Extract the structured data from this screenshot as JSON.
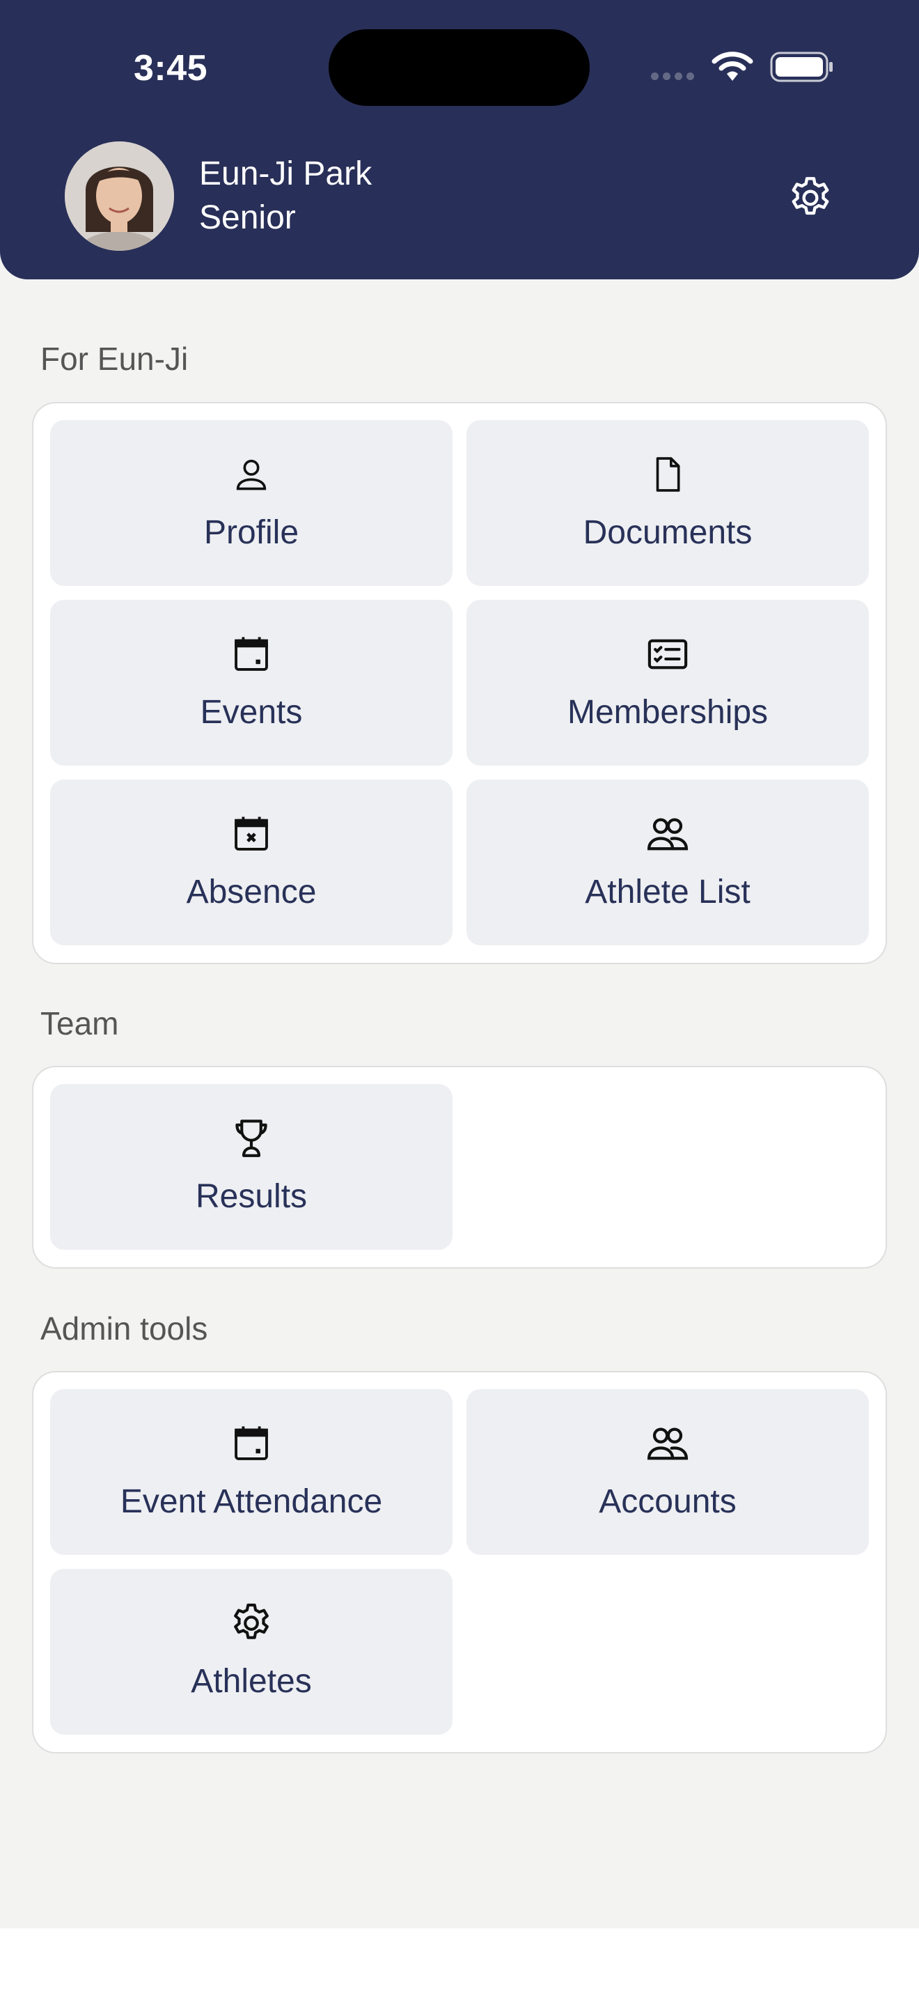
{
  "status_bar": {
    "time": "3:45"
  },
  "header": {
    "user_name": "Eun-Ji Park",
    "user_role": "Senior",
    "settings_icon": "gear-icon",
    "background_color": "#282f58"
  },
  "sections": [
    {
      "title": "For Eun-Ji",
      "tiles": [
        {
          "label": "Profile",
          "icon": "person-icon"
        },
        {
          "label": "Documents",
          "icon": "document-icon"
        },
        {
          "label": "Events",
          "icon": "calendar-icon"
        },
        {
          "label": "Memberships",
          "icon": "id-card-icon"
        },
        {
          "label": "Absence",
          "icon": "calendar-x-icon"
        },
        {
          "label": "Athlete List",
          "icon": "people-icon"
        }
      ]
    },
    {
      "title": "Team",
      "tiles": [
        {
          "label": "Results",
          "icon": "trophy-icon"
        }
      ]
    },
    {
      "title": "Admin tools",
      "tiles": [
        {
          "label": "Event Attendance",
          "icon": "calendar-icon"
        },
        {
          "label": "Accounts",
          "icon": "people-icon"
        },
        {
          "label": "Athletes",
          "icon": "gear-icon"
        }
      ]
    }
  ],
  "colors": {
    "accent": "#282f58",
    "tile_bg": "#eeeff2",
    "page_bg": "#f3f3f2"
  }
}
